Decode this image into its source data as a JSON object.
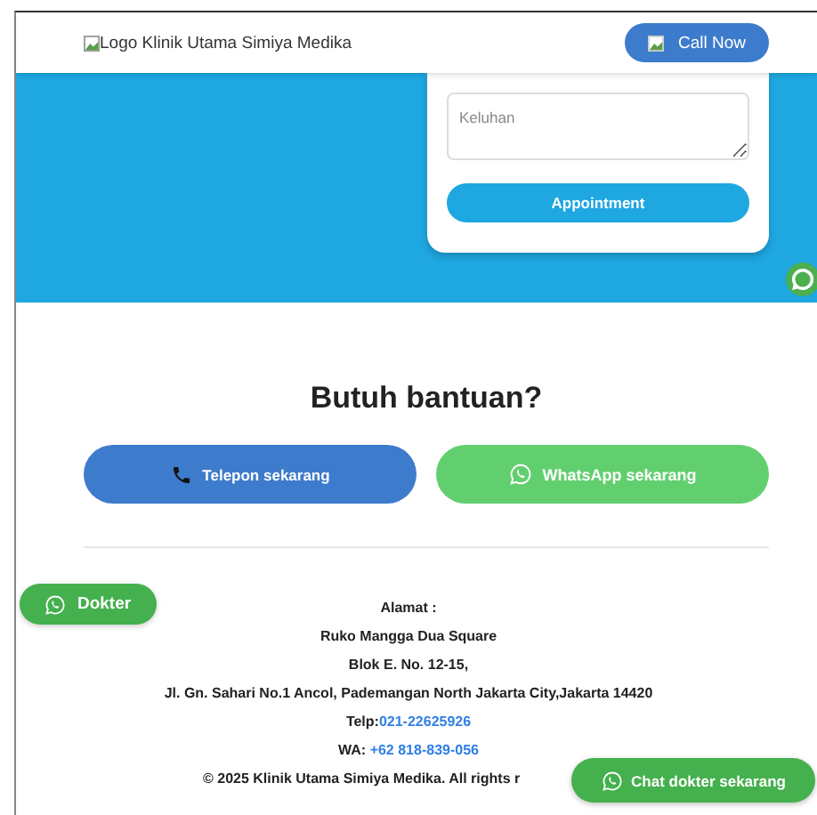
{
  "header": {
    "logo_alt": "Logo Klinik Utama Simiya Medika",
    "call_button": "Call Now"
  },
  "appointment_form": {
    "complaint_placeholder": "Keluhan",
    "submit_button": "Appointment"
  },
  "help": {
    "title": "Butuh bantuan?",
    "buttons": [
      {
        "kind": "phone",
        "label": "Telepon sekarang"
      },
      {
        "kind": "whatsapp",
        "label": "WhatsApp sekarang"
      }
    ]
  },
  "footer": {
    "address_label": "Alamat :",
    "address_lines": [
      "Ruko Mangga Dua Square",
      "Blok E. No. 12-15,",
      "Jl. Gn. Sahari No.1 Ancol, Pademangan North Jakarta City,Jakarta 14420"
    ],
    "phone": {
      "label": "Telp:",
      "value": "021-22625926"
    },
    "whatsapp": {
      "label": "WA:",
      "value": "+62 818-839-056"
    },
    "copyright": "© 2025 Klinik Utama Simiya Medika. All rights r"
  },
  "floating": {
    "doctor_button": "Dokter",
    "chat_button": "Chat dokter sekarang"
  }
}
